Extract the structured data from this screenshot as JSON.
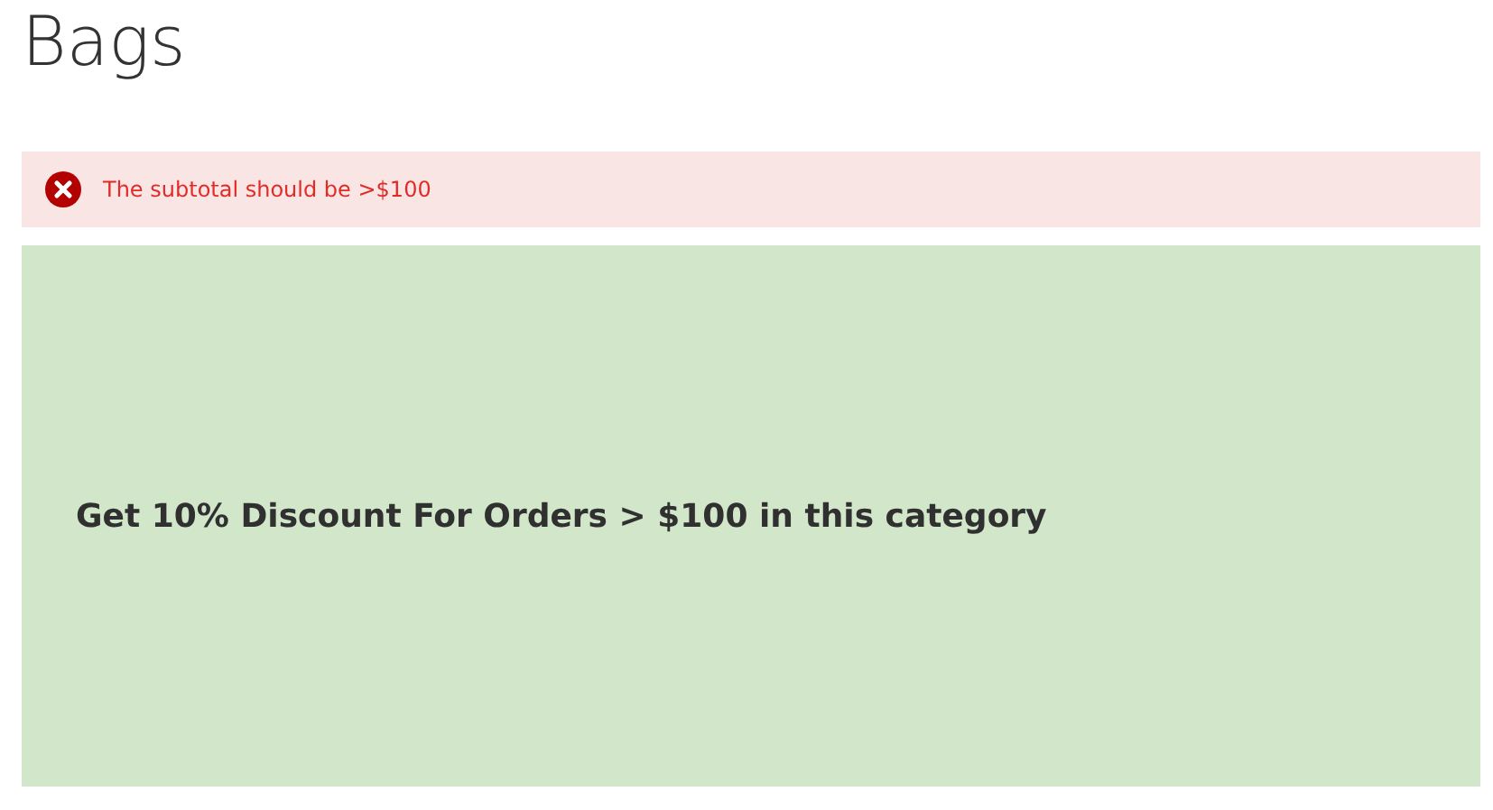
{
  "page_title": "Bags",
  "message": {
    "kind": "error",
    "text": "The subtotal should be >$100"
  },
  "banner": {
    "text": "Get 10% Discount For Orders > $100 in this category"
  }
}
